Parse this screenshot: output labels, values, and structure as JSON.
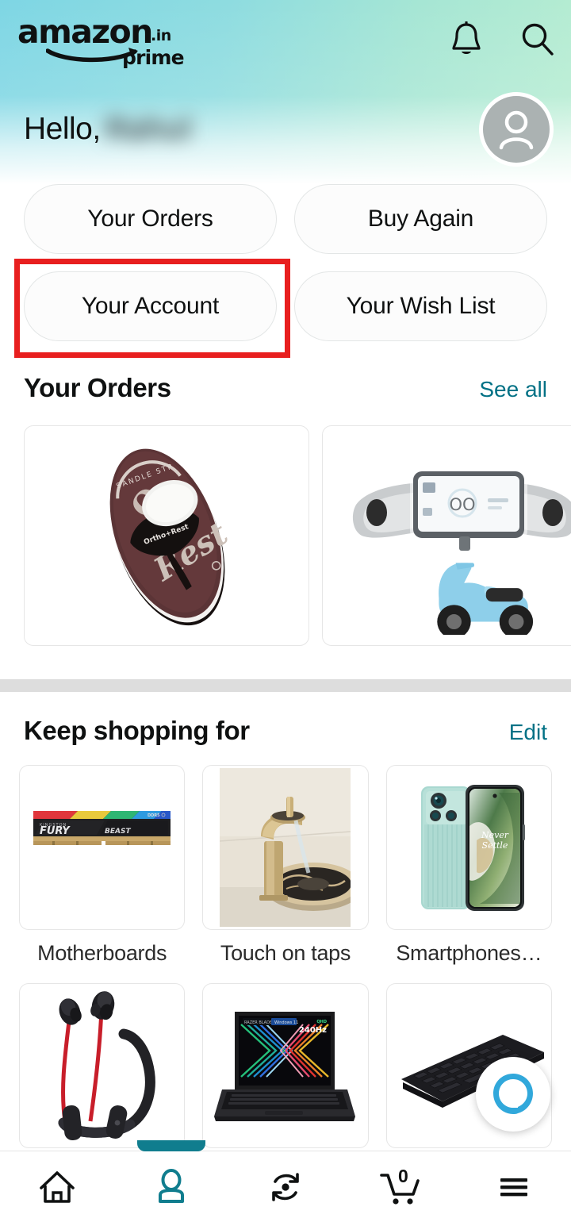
{
  "app": {
    "brand_word": "amazon",
    "brand_tld": ".in",
    "brand_sub": "prime",
    "accent_teal": "#017185",
    "nav_active_color": "#107D8E",
    "annotation_color": "#E81F1F",
    "header_gradient_from": "#7ED6E4",
    "header_gradient_to": "#B7EDD2"
  },
  "topbar": {
    "notifications_icon": "bell-icon",
    "search_icon": "search-icon"
  },
  "greeting": {
    "hello": "Hello,",
    "name": "Rahul",
    "name_redacted": true,
    "avatar_icon": "person-avatar-icon"
  },
  "quick_actions": [
    {
      "label": "Your Orders",
      "name": "your-orders"
    },
    {
      "label": "Buy Again",
      "name": "buy-again"
    },
    {
      "label": "Your Account",
      "name": "your-account",
      "highlighted": true
    },
    {
      "label": "Your Wish List",
      "name": "your-wish-list"
    }
  ],
  "orders_section": {
    "title": "Your Orders",
    "link": "See all",
    "items": [
      {
        "name": "flip-flop-sandal",
        "alt": "Brown flip-flop sandal"
      },
      {
        "name": "scooter-screen-protector",
        "alt": "Electric scooter dashboard screen protector"
      }
    ]
  },
  "keep_shopping": {
    "title": "Keep shopping for",
    "link": "Edit",
    "tiles": [
      {
        "label": "Motherboards",
        "name": "motherboards",
        "alt": "Kingston FURY Beast RGB RAM module"
      },
      {
        "label": "Touch on taps",
        "name": "touch-on-taps",
        "alt": "Gold waterfall basin tap"
      },
      {
        "label": "Smartphones…",
        "name": "smartphones",
        "alt": "Mint green OnePlus smartphone, Never Settle wallpaper"
      },
      {
        "label": "",
        "name": "earphones",
        "alt": "Red and black neckband wireless earphones"
      },
      {
        "label": "",
        "name": "gaming-laptop",
        "alt": "Razer gaming laptop, 240Hz display"
      },
      {
        "label": "",
        "name": "keyboard",
        "alt": "Black mechanical keyboard"
      }
    ]
  },
  "alexa": {
    "icon": "alexa-icon",
    "color": "#31A8DB"
  },
  "bottom_nav": [
    {
      "name": "home",
      "icon": "home-icon",
      "active": false
    },
    {
      "name": "account",
      "icon": "person-icon",
      "active": true
    },
    {
      "name": "rescan",
      "icon": "refresh-scan-icon",
      "active": false
    },
    {
      "name": "cart",
      "icon": "cart-icon",
      "active": false,
      "badge": "0"
    },
    {
      "name": "menu",
      "icon": "hamburger-menu-icon",
      "active": false
    }
  ]
}
